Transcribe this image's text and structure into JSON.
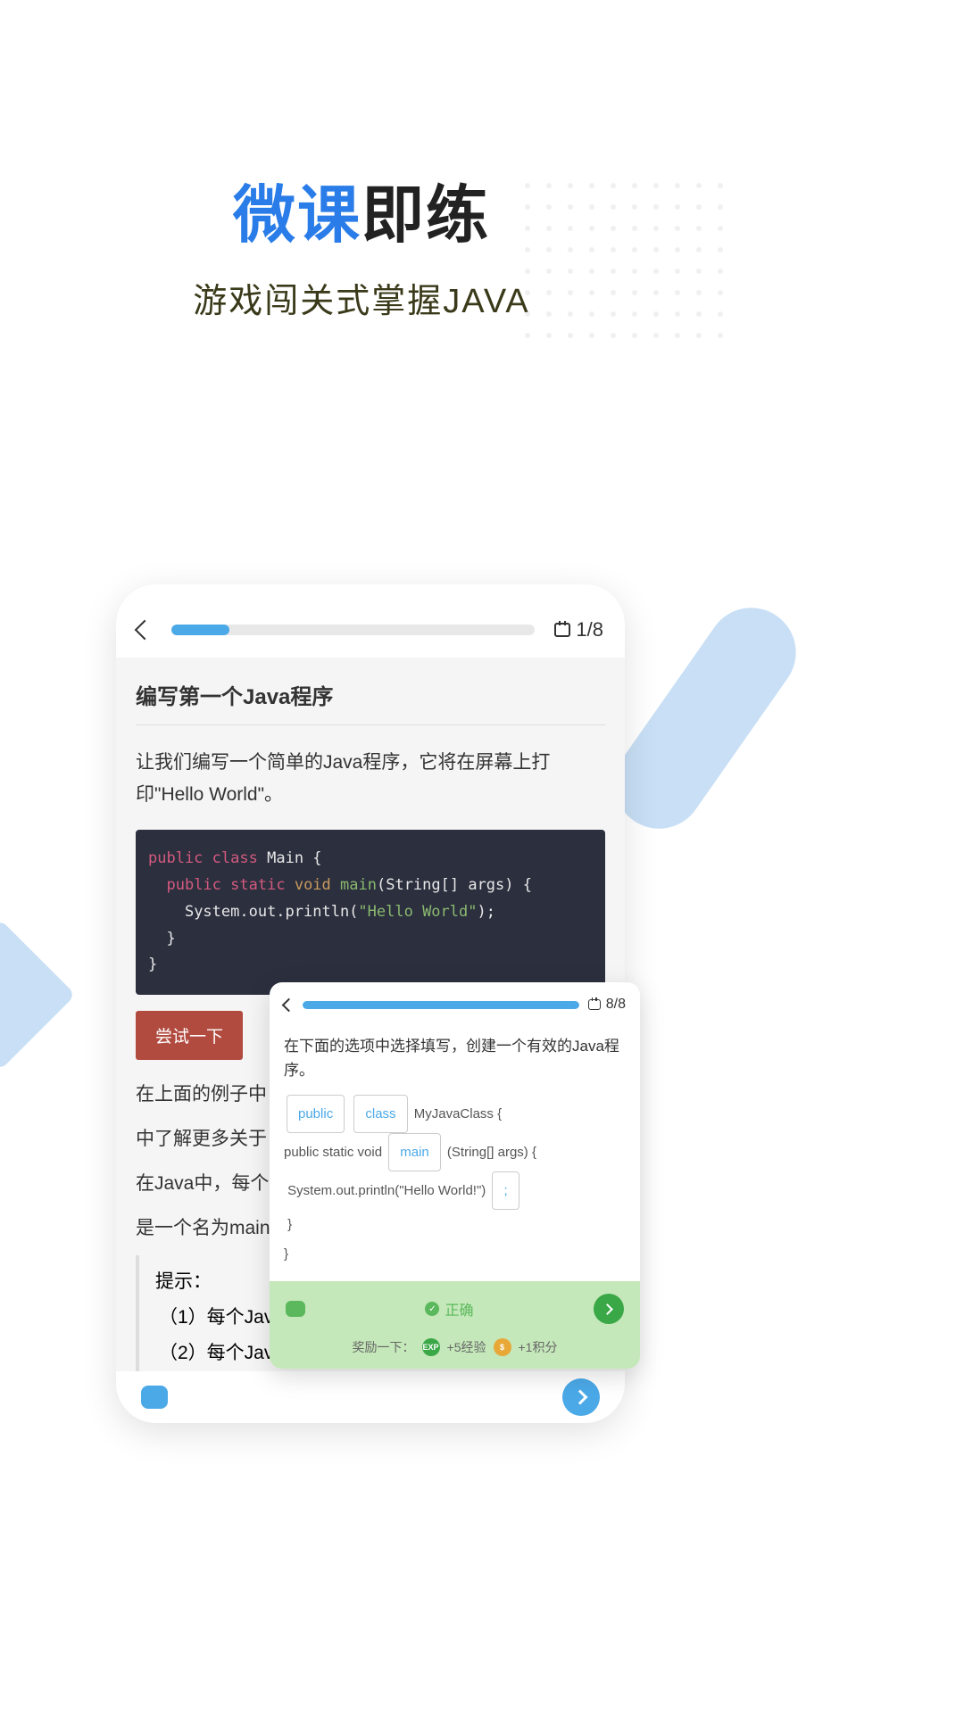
{
  "hero": {
    "title_blue": "微课",
    "title_dark": "即练",
    "subtitle": "游戏闯关式掌握JAVA"
  },
  "phone": {
    "counter": "1/8",
    "lesson_title": "编写第一个Java程序",
    "lesson_desc": "让我们编写一个简单的Java程序，它将在屏幕上打印\"Hello World\"。",
    "code": {
      "kw_public": "public",
      "kw_class": "class",
      "kw_static": "static",
      "kw_void": "void",
      "fn_main": "main",
      "name_Main": "Main",
      "args": "(String[] args) {",
      "println": "System.out.println(",
      "hello": "\"Hello World\"",
      "close_println": ");",
      "brace": "}"
    },
    "try_button": "尝试一下",
    "para1": "在上面的例子中，",
    "para2": "中了解更多关于",
    "para3": "在Java中，每个",
    "para4": "是一个名为main",
    "tip_title": "提示：",
    "tip1": "（1）每个Jav",
    "tip2": "（2）每个Jav"
  },
  "popup": {
    "counter": "8/8",
    "question": "在下面的选项中选择填写，创建一个有效的Java程序。",
    "chip_public": "public",
    "chip_class": "class",
    "chip_main": "main",
    "chip_semi": ";",
    "text_after_class": "MyJavaClass {",
    "l2": "public static void",
    "l2_after": "(String[] args) {",
    "l3": "System.out.println(\"Hello World!\")",
    "brace_close": "}",
    "status": "正确",
    "rewards_label": "奖励一下：",
    "exp_label": "+5经验",
    "coin_label": "+1积分",
    "exp_badge": "EXP",
    "coin_badge": "$"
  }
}
